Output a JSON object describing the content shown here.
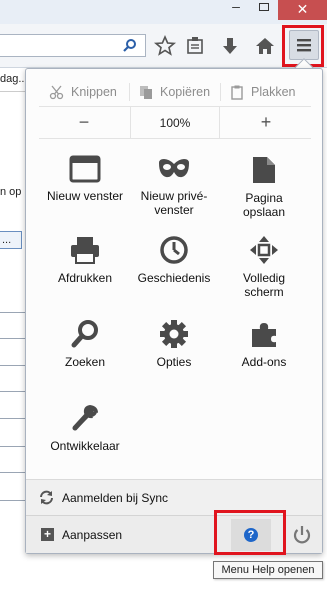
{
  "window": {
    "minimize": "–",
    "close": "✕"
  },
  "bookmarks": {
    "partial_text": "dag..."
  },
  "background": {
    "partial_text": "n op",
    "partial_button": "..."
  },
  "edit": {
    "cut": "Knippen",
    "copy": "Kopiëren",
    "paste": "Plakken"
  },
  "zoom": {
    "out": "−",
    "level": "100%",
    "in": "+"
  },
  "tiles": [
    {
      "label": "Nieuw venster",
      "icon": "new-window-icon"
    },
    {
      "label": "Nieuw privévenster",
      "icon": "private-mask-icon"
    },
    {
      "label": "Pagina opslaan",
      "icon": "save-page-icon"
    },
    {
      "label": "Afdrukken",
      "icon": "printer-icon"
    },
    {
      "label": "Geschiedenis",
      "icon": "history-clock-icon"
    },
    {
      "label": "Volledig scherm",
      "icon": "fullscreen-icon"
    },
    {
      "label": "Zoeken",
      "icon": "search-icon"
    },
    {
      "label": "Opties",
      "icon": "gear-icon"
    },
    {
      "label": "Add-ons",
      "icon": "puzzle-icon"
    },
    {
      "label": "Ontwikkelaar",
      "icon": "wrench-icon"
    }
  ],
  "tile_lines": {
    "new_private_1": "Nieuw privé-",
    "new_private_2": "venster",
    "save_1": "Pagina",
    "save_2": "opslaan",
    "fullscreen_1": "Volledig",
    "fullscreen_2": "scherm"
  },
  "sync": {
    "label": "Aanmelden bij Sync"
  },
  "footer": {
    "customize": "Aanpassen",
    "help": "?"
  },
  "tooltip": {
    "text": "Menu Help openen"
  },
  "colors": {
    "highlight": "#e0141e",
    "help_blue": "#1e66c9",
    "close_red": "#c74f50"
  }
}
